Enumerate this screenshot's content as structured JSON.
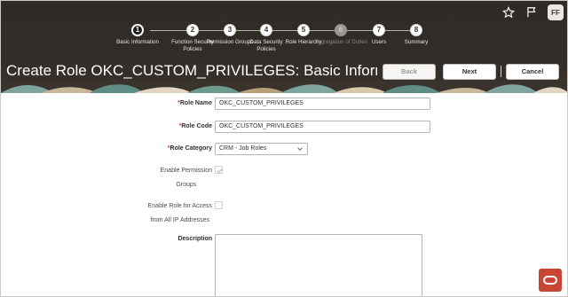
{
  "header": {
    "avatar_initials": "FF",
    "page_title": "Create Role OKC_CUSTOM_PRIVILEGES: Basic Informati...",
    "buttons": {
      "back": "Back",
      "next": "Next",
      "cancel": "Cancel"
    }
  },
  "train": {
    "steps": [
      {
        "num": "1",
        "label": "Basic Information",
        "state": "current"
      },
      {
        "num": "2",
        "label": "Function Security Policies",
        "state": "enabled"
      },
      {
        "num": "3",
        "label": "Permission Groups",
        "state": "enabled"
      },
      {
        "num": "4",
        "label": "Data Security Policies",
        "state": "enabled"
      },
      {
        "num": "5",
        "label": "Role Hierarchy",
        "state": "enabled"
      },
      {
        "num": "6",
        "label": "Segregation of Duties",
        "state": "disabled"
      },
      {
        "num": "7",
        "label": "Users",
        "state": "enabled"
      },
      {
        "num": "8",
        "label": "Summary",
        "state": "enabled"
      }
    ]
  },
  "form": {
    "role_name": {
      "label": "Role Name",
      "required_mark": "*",
      "value": "OKC_CUSTOM_PRIVILEGES"
    },
    "role_code": {
      "label": "Role Code",
      "required_mark": "*",
      "value": "OKC_CUSTOM_PRIVILEGES"
    },
    "role_category": {
      "label": "Role Category",
      "required_mark": "*",
      "value": "CRM - Job Roles"
    },
    "enable_permission_groups": {
      "label_line1": "Enable Permission",
      "label_line2": "Groups",
      "checked": true,
      "disabled": true
    },
    "enable_role_access": {
      "label_line1": "Enable Role for Access",
      "label_line2": "from All IP Addresses",
      "checked": false
    },
    "description": {
      "label": "Description",
      "value": ""
    }
  },
  "icons": {
    "favorite": "star-icon",
    "flag": "flag-icon",
    "brand": "oracle-logo-icon",
    "chevron": "chevron-down-icon",
    "check": "check-icon"
  },
  "colors": {
    "header_bg": "#2f2b27",
    "oracle_red": "#c74634",
    "required": "#c74634"
  }
}
